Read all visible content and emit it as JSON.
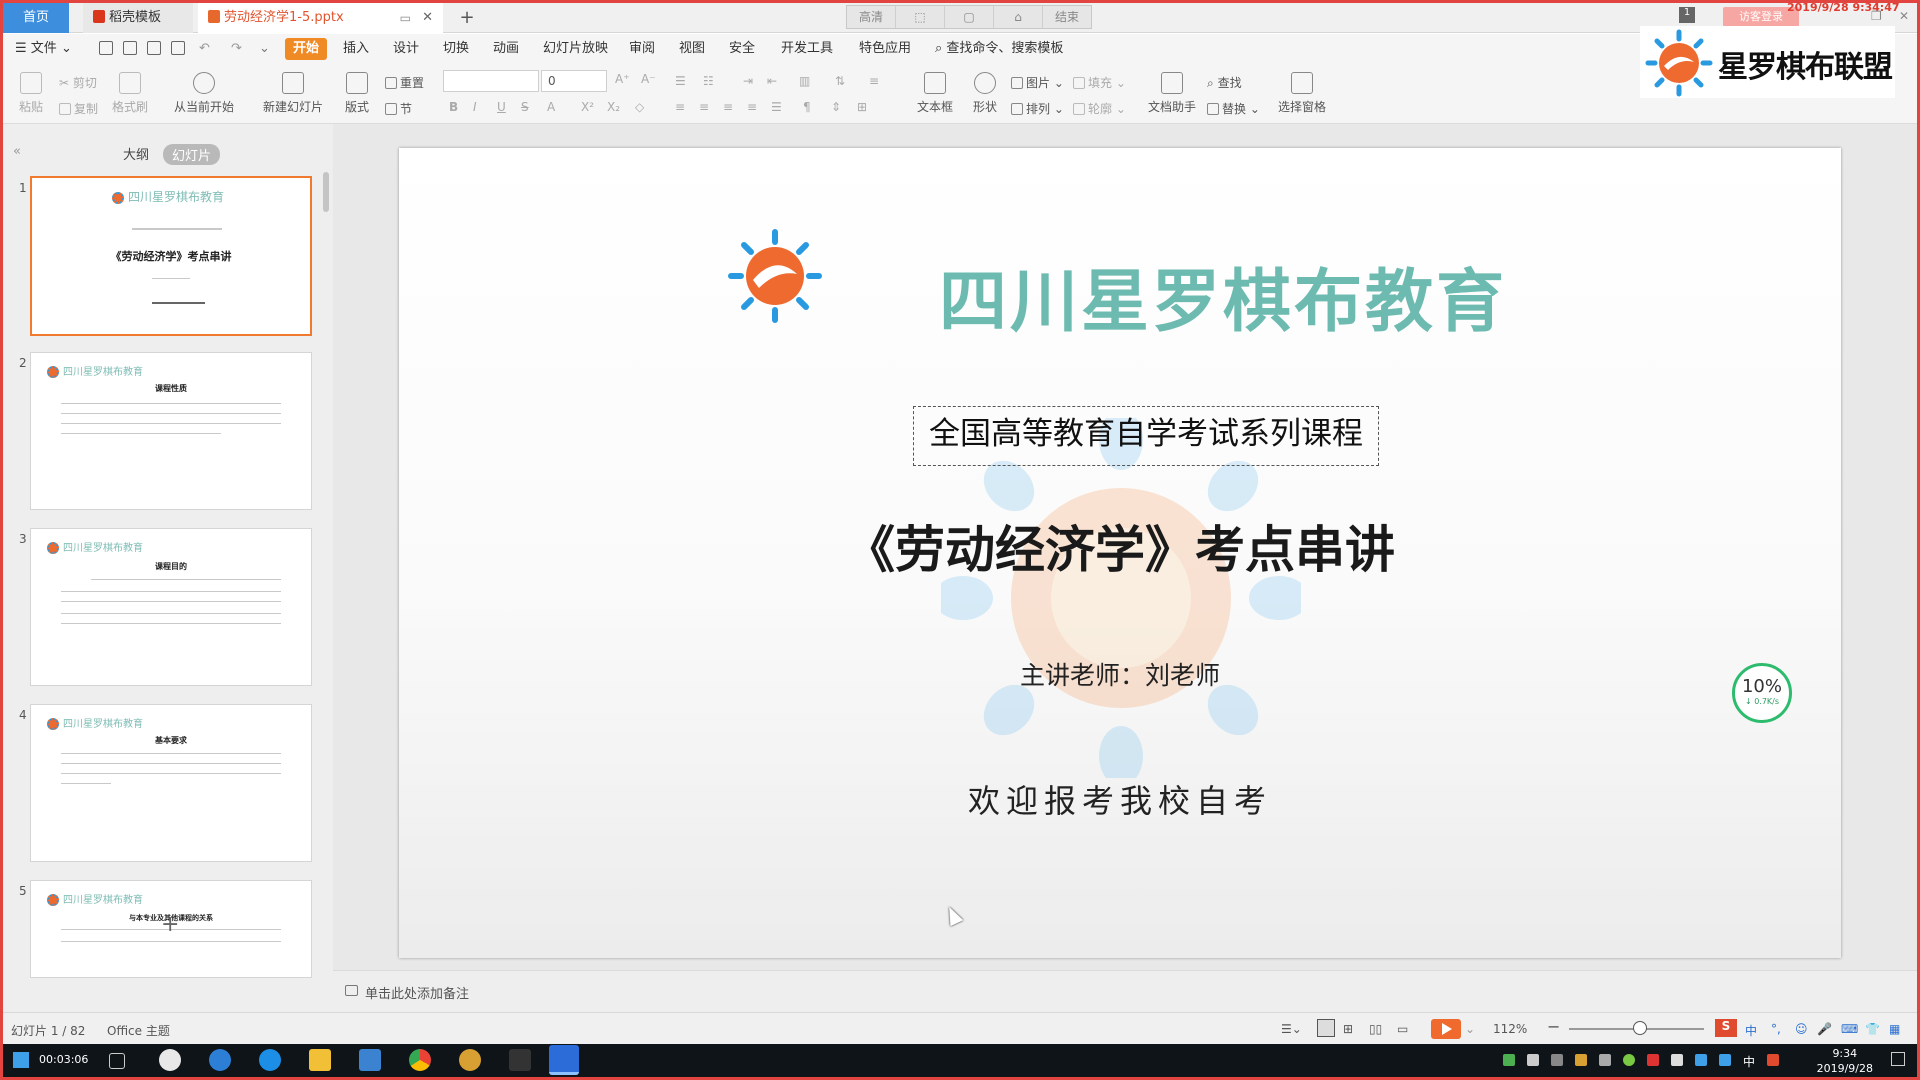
{
  "tabs": {
    "home": "首页",
    "templates": "稻壳模板",
    "file": "劳动经济学1-5.pptx"
  },
  "recording_bar": [
    "高清",
    "",
    "",
    "",
    "结束"
  ],
  "recording_time": "2019/9/28  9:34:47",
  "login": "访客登录",
  "menu": {
    "file": "文件",
    "items": [
      "开始",
      "插入",
      "设计",
      "切换",
      "动画",
      "幻灯片放映",
      "审阅",
      "视图",
      "安全",
      "开发工具",
      "特色应用"
    ],
    "search": "查找命令、搜索模板"
  },
  "ribbon": {
    "paste": "粘贴",
    "cut": "剪切",
    "copy": "复制",
    "format_painter": "格式刷",
    "play_from_current": "从当前开始",
    "new_slide": "新建幻灯片",
    "layout": "版式",
    "reset": "重置",
    "section": "节",
    "font_size": "0",
    "textbox": "文本框",
    "shape": "形状",
    "picture": "图片",
    "fill": "填充",
    "arrange": "排列",
    "outline": "轮廓",
    "doc_assistant": "文档助手",
    "find": "查找",
    "replace": "替换",
    "select_pane": "选择窗格"
  },
  "logo": {
    "text": "星罗棋布联盟"
  },
  "panel": {
    "outline_tab": "大纲",
    "slides_tab": "幻灯片"
  },
  "thumbnails": [
    {
      "num": "1",
      "logo": "四川星罗棋布教育",
      "title": "《劳动经济学》考点串讲"
    },
    {
      "num": "2",
      "logo": "四川星罗棋布教育",
      "title": "课程性质"
    },
    {
      "num": "3",
      "logo": "四川星罗棋布教育",
      "title": "课程目的"
    },
    {
      "num": "4",
      "logo": "四川星罗棋布教育",
      "title": "基本要求"
    },
    {
      "num": "5",
      "logo": "四川星罗棋布教育",
      "title": "与本专业及其他课程的关系"
    }
  ],
  "slide": {
    "org": "四川星罗棋布教育",
    "subtitle": "全国高等教育自学考试系列课程",
    "title": "《劳动经济学》考点串讲",
    "teacher": "主讲老师：刘老师",
    "welcome": "欢迎报考我校自考"
  },
  "speed": {
    "pct": "10%",
    "rate": "↓ 0.7K/s"
  },
  "notes_placeholder": "单击此处添加备注",
  "status": {
    "slide_count": "幻灯片 1 / 82",
    "theme": "Office 主题",
    "zoom": "112%"
  },
  "taskbar": {
    "rec_counter": "00:03:06",
    "time": "9:34",
    "date": "2019/9/28",
    "ime": "中"
  },
  "colors": {
    "accent_orange": "#f08a24",
    "frame_red": "#e2453f",
    "logo_teal": "#6dbbb0",
    "sun_orange": "#ee6a2f",
    "sun_blue": "#2a9ae0"
  }
}
